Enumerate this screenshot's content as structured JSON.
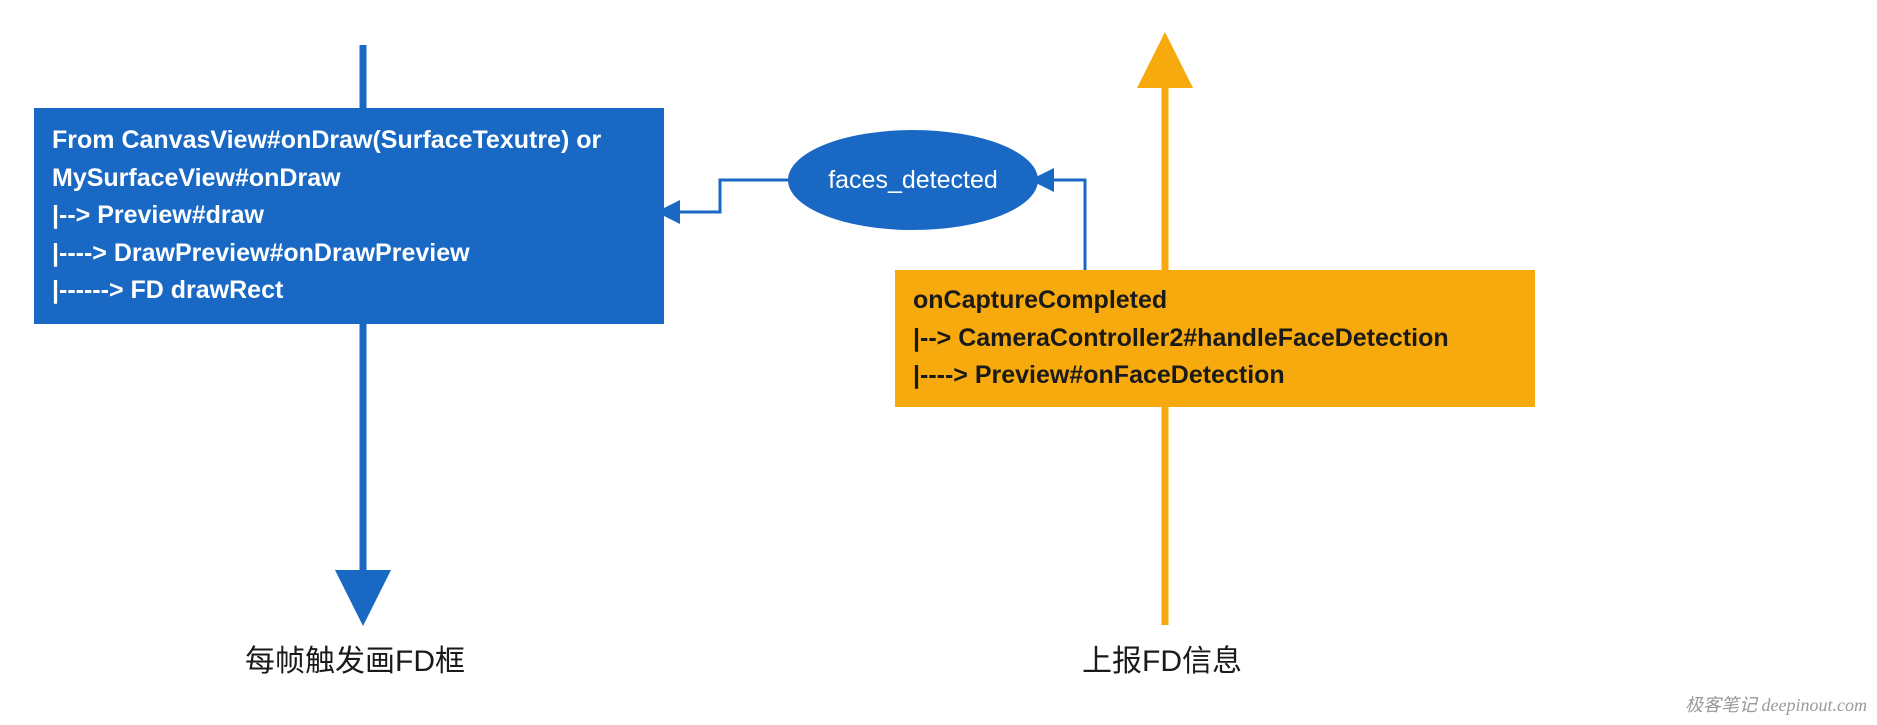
{
  "blueBox": {
    "line1": "From CanvasView#onDraw(SurfaceTexutre) or",
    "line2": "MySurfaceView#onDraw",
    "line3": "|--> Preview#draw",
    "line4": "|----> DrawPreview#onDrawPreview",
    "line5": "|------> FD drawRect"
  },
  "yellowBox": {
    "line1": "onCaptureCompleted",
    "line2": "|--> CameraController2#handleFaceDetection",
    "line3": "|----> Preview#onFaceDetection"
  },
  "ellipse": {
    "label": "faces_detected"
  },
  "captions": {
    "left": "每帧触发画FD框",
    "right": "上报FD信息"
  },
  "colors": {
    "blue": "#1868c4",
    "yellow": "#f7aa0d"
  },
  "watermark": "极客笔记 deepinout.com"
}
